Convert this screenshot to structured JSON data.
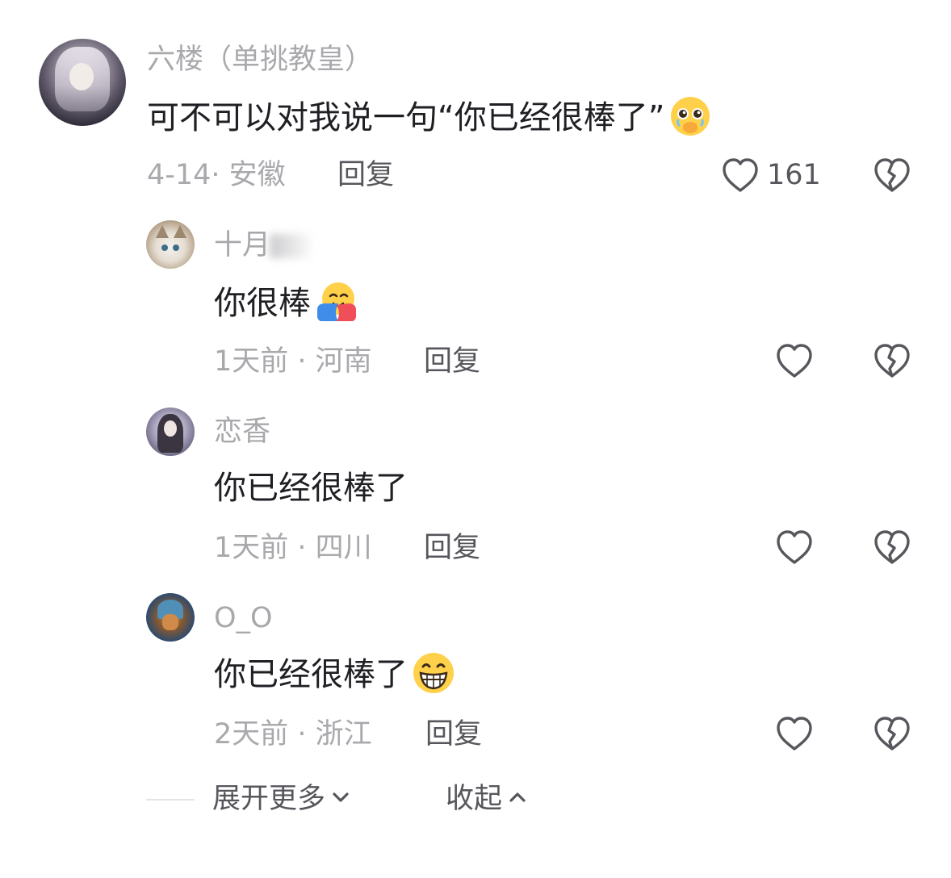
{
  "main_comment": {
    "username": "六楼（单挑教皇）",
    "text": "可不可以对我说一句“你已经很棒了”",
    "emoji_icon": "pleading-face-emoji",
    "meta": "4-14· 安徽",
    "reply_label": "回复",
    "like_count": "161"
  },
  "replies": [
    {
      "username": "十月",
      "text": "你很棒",
      "emoji_icon": "hugging-face-emoji",
      "meta": "1天前 · 河南",
      "reply_label": "回复"
    },
    {
      "username": "恋香",
      "text": "你已经很棒了",
      "emoji_icon": "",
      "meta": "1天前 · 四川",
      "reply_label": "回复"
    },
    {
      "username": "O_O",
      "text": "你已经很棒了",
      "emoji_icon": "grinning-face-emoji",
      "meta": "2天前 · 浙江",
      "reply_label": "回复"
    }
  ],
  "footer": {
    "expand_label": "展开更多",
    "collapse_label": "收起"
  },
  "colors": {
    "username": "#a9a9ad",
    "text": "#1f1f24",
    "meta": "#a9a9ad",
    "action": "#56565c",
    "icon_stroke": "#56565c"
  }
}
